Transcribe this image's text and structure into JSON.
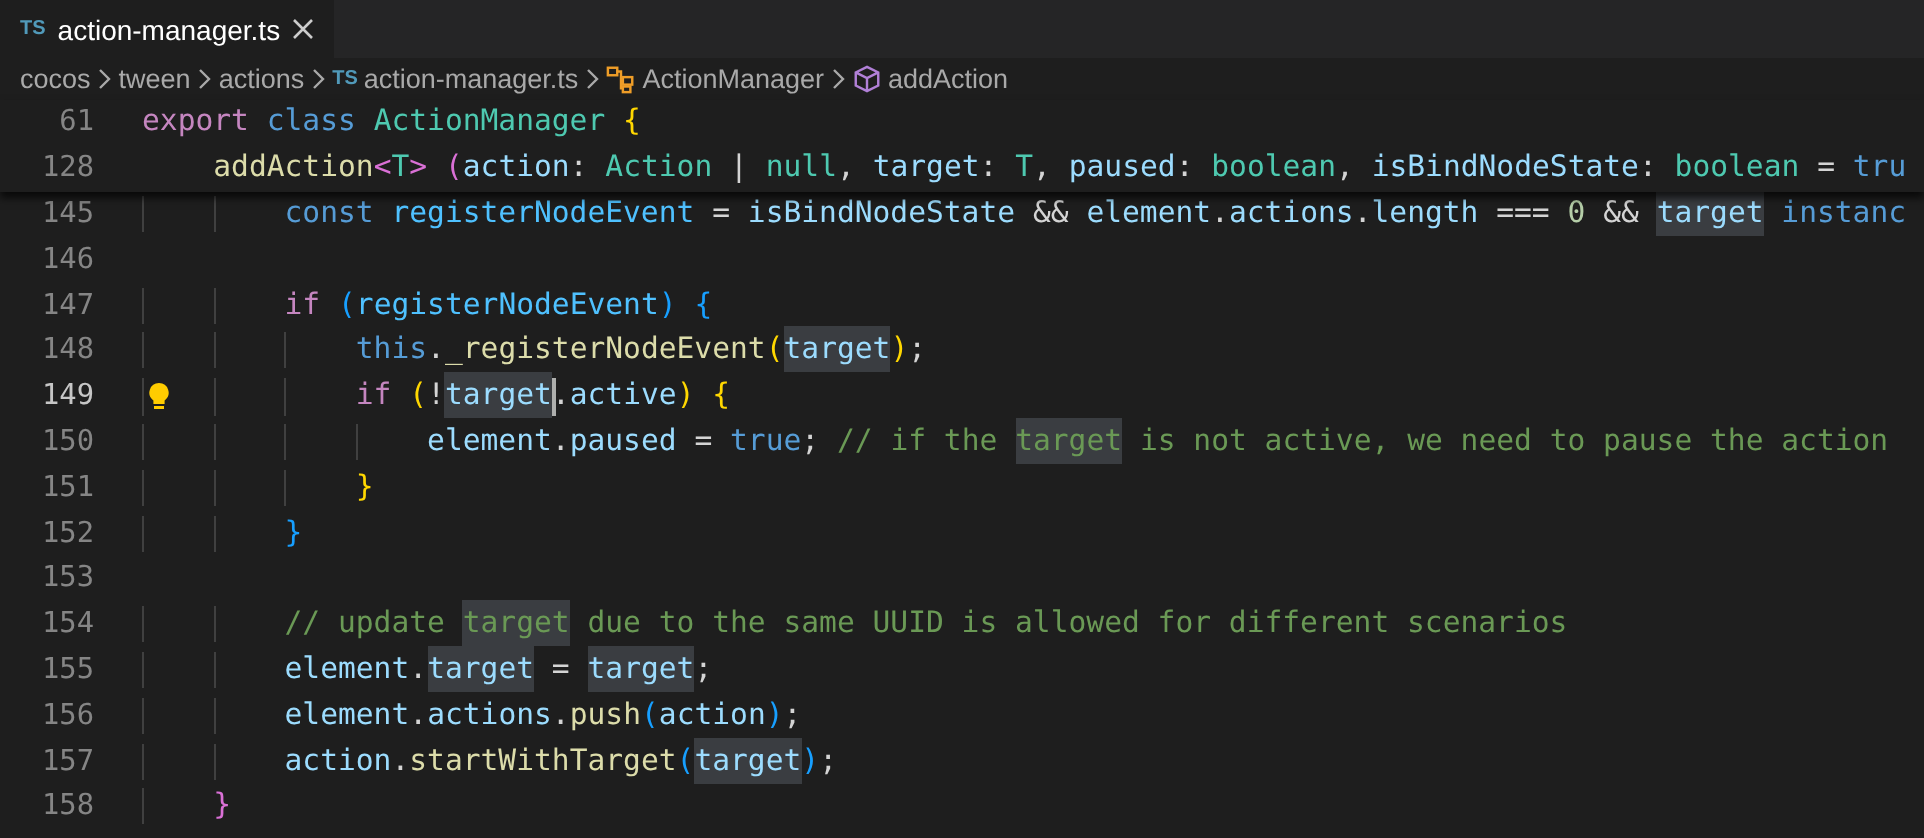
{
  "tabs": [
    {
      "badge": "TS",
      "label": "action-manager.ts",
      "selected": true
    }
  ],
  "breadcrumbs": [
    {
      "label": "cocos",
      "kind": "folder"
    },
    {
      "label": "tween",
      "kind": "folder"
    },
    {
      "label": "actions",
      "kind": "folder"
    },
    {
      "label": "action-manager.ts",
      "kind": "file",
      "badge": "TS"
    },
    {
      "label": "ActionManager",
      "kind": "class"
    },
    {
      "label": "addAction",
      "kind": "method"
    }
  ],
  "sticky_lines": [
    {
      "number": "61",
      "tokens": [
        {
          "t": "export ",
          "kind": "keyword"
        },
        {
          "t": "class ",
          "kind": "storage"
        },
        {
          "t": "ActionManager ",
          "kind": "type"
        },
        {
          "t": "{",
          "kind": "bracket1"
        }
      ]
    },
    {
      "number": "128",
      "tokens": [
        {
          "t": "    addAction",
          "kind": "func"
        },
        {
          "t": "<",
          "kind": "bracket2"
        },
        {
          "t": "T",
          "kind": "type"
        },
        {
          "t": "> (",
          "kind": "bracket2"
        },
        {
          "t": "action",
          "kind": "var"
        },
        {
          "t": ": ",
          "kind": "plain"
        },
        {
          "t": "Action",
          "kind": "type"
        },
        {
          "t": " | ",
          "kind": "plain"
        },
        {
          "t": "null",
          "kind": "type"
        },
        {
          "t": ", ",
          "kind": "plain"
        },
        {
          "t": "target",
          "kind": "var"
        },
        {
          "t": ": ",
          "kind": "plain"
        },
        {
          "t": "T",
          "kind": "type"
        },
        {
          "t": ", ",
          "kind": "plain"
        },
        {
          "t": "paused",
          "kind": "var"
        },
        {
          "t": ": ",
          "kind": "plain"
        },
        {
          "t": "boolean",
          "kind": "type"
        },
        {
          "t": ", ",
          "kind": "plain"
        },
        {
          "t": "isBindNodeState",
          "kind": "var"
        },
        {
          "t": ": ",
          "kind": "plain"
        },
        {
          "t": "boolean",
          "kind": "type"
        },
        {
          "t": " = ",
          "kind": "plain"
        },
        {
          "t": "tru",
          "kind": "storage"
        }
      ]
    }
  ],
  "lines": [
    {
      "number": "145",
      "tokens": [
        {
          "t": "        const ",
          "kind": "storage"
        },
        {
          "t": "registerNodeEvent",
          "kind": "const"
        },
        {
          "t": " = ",
          "kind": "plain"
        },
        {
          "t": "isBindNodeState",
          "kind": "var"
        },
        {
          "t": " && ",
          "kind": "plain"
        },
        {
          "t": "element",
          "kind": "var"
        },
        {
          "t": ".",
          "kind": "plain"
        },
        {
          "t": "actions",
          "kind": "var"
        },
        {
          "t": ".",
          "kind": "plain"
        },
        {
          "t": "length",
          "kind": "var"
        },
        {
          "t": " === ",
          "kind": "plain"
        },
        {
          "t": "0",
          "kind": "number"
        },
        {
          "t": " && ",
          "kind": "plain"
        },
        {
          "t": "target",
          "kind": "var",
          "highlighted": true
        },
        {
          "t": " instanc",
          "kind": "storage"
        }
      ]
    },
    {
      "number": "146"
    },
    {
      "number": "147",
      "tokens": [
        {
          "t": "        if ",
          "kind": "keyword"
        },
        {
          "t": "(",
          "kind": "bracket3"
        },
        {
          "t": "registerNodeEvent",
          "kind": "const"
        },
        {
          "t": ") {",
          "kind": "bracket3"
        }
      ]
    },
    {
      "number": "148",
      "tokens": [
        {
          "t": "            this",
          "kind": "storage"
        },
        {
          "t": ".",
          "kind": "plain"
        },
        {
          "t": "_registerNodeEvent",
          "kind": "func"
        },
        {
          "t": "(",
          "kind": "bracket1"
        },
        {
          "t": "target",
          "kind": "var",
          "highlighted": true
        },
        {
          "t": ")",
          "kind": "bracket1"
        },
        {
          "t": ";",
          "kind": "plain"
        }
      ]
    },
    {
      "number": "149",
      "current": true,
      "lightbulb": true,
      "tokens": [
        {
          "t": "            if ",
          "kind": "keyword"
        },
        {
          "t": "(",
          "kind": "bracket1"
        },
        {
          "t": "!",
          "kind": "plain"
        },
        {
          "t": "target",
          "kind": "var",
          "highlighted": true,
          "cursor": true
        },
        {
          "t": ".",
          "kind": "plain"
        },
        {
          "t": "active",
          "kind": "var"
        },
        {
          "t": ") {",
          "kind": "bracket1"
        }
      ]
    },
    {
      "number": "150",
      "tokens": [
        {
          "t": "                element",
          "kind": "var"
        },
        {
          "t": ".",
          "kind": "plain"
        },
        {
          "t": "paused",
          "kind": "var"
        },
        {
          "t": " = ",
          "kind": "plain"
        },
        {
          "t": "true",
          "kind": "storage"
        },
        {
          "t": "; ",
          "kind": "plain"
        },
        {
          "t": "// if the ",
          "kind": "comment"
        },
        {
          "t": "target",
          "kind": "comment",
          "highlighted": true
        },
        {
          "t": " is not active, we need to pause the action",
          "kind": "comment"
        }
      ]
    },
    {
      "number": "151",
      "tokens": [
        {
          "t": "            }",
          "kind": "bracket1"
        }
      ]
    },
    {
      "number": "152",
      "tokens": [
        {
          "t": "        }",
          "kind": "bracket3"
        }
      ]
    },
    {
      "number": "153"
    },
    {
      "number": "154",
      "tokens": [
        {
          "t": "        // update ",
          "kind": "comment"
        },
        {
          "t": "target",
          "kind": "comment",
          "highlighted": true
        },
        {
          "t": " due to the same UUID is allowed for different scenarios",
          "kind": "comment"
        }
      ]
    },
    {
      "number": "155",
      "tokens": [
        {
          "t": "        element",
          "kind": "var"
        },
        {
          "t": ".",
          "kind": "plain"
        },
        {
          "t": "target",
          "kind": "var",
          "highlighted": true
        },
        {
          "t": " = ",
          "kind": "plain"
        },
        {
          "t": "target",
          "kind": "var",
          "highlighted": true
        },
        {
          "t": ";",
          "kind": "plain"
        }
      ]
    },
    {
      "number": "156",
      "tokens": [
        {
          "t": "        element",
          "kind": "var"
        },
        {
          "t": ".",
          "kind": "plain"
        },
        {
          "t": "actions",
          "kind": "var"
        },
        {
          "t": ".",
          "kind": "plain"
        },
        {
          "t": "push",
          "kind": "func"
        },
        {
          "t": "(",
          "kind": "bracket3"
        },
        {
          "t": "action",
          "kind": "var"
        },
        {
          "t": ")",
          "kind": "bracket3"
        },
        {
          "t": ";",
          "kind": "plain"
        }
      ]
    },
    {
      "number": "157",
      "tokens": [
        {
          "t": "        action",
          "kind": "var"
        },
        {
          "t": ".",
          "kind": "plain"
        },
        {
          "t": "startWithTarget",
          "kind": "func"
        },
        {
          "t": "(",
          "kind": "bracket3"
        },
        {
          "t": "target",
          "kind": "var",
          "highlighted": true
        },
        {
          "t": ")",
          "kind": "bracket3"
        },
        {
          "t": ";",
          "kind": "plain"
        }
      ]
    },
    {
      "number": "158",
      "tokens": [
        {
          "t": "    }",
          "kind": "bracket2"
        }
      ]
    }
  ]
}
